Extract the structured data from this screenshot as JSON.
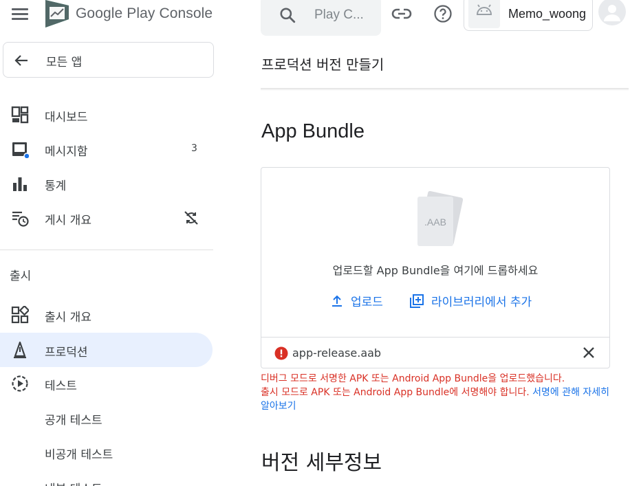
{
  "header": {
    "brand_prefix": "Google Play",
    "brand_suffix": "Console",
    "search_placeholder": "Play C...",
    "account_name": "Memo_woong"
  },
  "sidebar": {
    "back_label": "모든 앱",
    "top_items": [
      {
        "label": "대시보드",
        "icon": "dashboard-icon"
      },
      {
        "label": "메시지함",
        "icon": "inbox-icon",
        "badge": "3"
      },
      {
        "label": "통계",
        "icon": "bar-chart-icon"
      },
      {
        "label": "게시 개요",
        "icon": "publishing-overview-icon",
        "trail_icon": "sync-disabled-icon"
      }
    ],
    "section_label": "출시",
    "release_items": [
      {
        "label": "출시 개요",
        "icon": "release-overview-icon"
      },
      {
        "label": "프로덕션",
        "icon": "production-icon",
        "active": true
      },
      {
        "label": "테스트",
        "icon": "testing-icon"
      },
      {
        "label": "공개 테스트"
      },
      {
        "label": "비공개 테스트"
      },
      {
        "label": "내부 테스트"
      }
    ]
  },
  "main": {
    "page_title": "프로덕션 버전 만들기",
    "section_title": "App Bundle",
    "drop_card": {
      "graphic_label": ".AAB",
      "hint": "업로드할 App Bundle을 여기에 드롭하세요",
      "upload_label": "업로드",
      "library_label": "라이브러리에서 추가",
      "file_name": "app-release.aab"
    },
    "error": {
      "line1": "디버그 모드로 서명한 APK 또는 Android App Bundle을 업로드했습니다.",
      "line2": "출시 모드로 APK 또는 Android App Bundle에 서명해야 합니다.",
      "link": "서명에 관해 자세히 알아보기"
    },
    "details_title": "버전 세부정보"
  },
  "colors": {
    "accent": "#1a73e8",
    "active_bg": "#e8f0fe",
    "error": "#d93025",
    "notification_dot": "#1a73e8"
  }
}
